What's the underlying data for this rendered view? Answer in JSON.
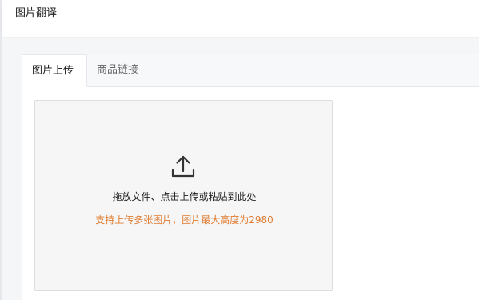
{
  "page": {
    "title": "图片翻译"
  },
  "tabs": [
    {
      "label": "图片上传",
      "active": true
    },
    {
      "label": "商品链接",
      "active": false
    }
  ],
  "upload": {
    "icon": "upload-icon",
    "instruction": "拖放文件、点击上传或粘贴到此处",
    "hint": "支持上传多张图片，图片最大高度为2980"
  },
  "colors": {
    "hint_color": "#e07b2f",
    "background": "#f5f6f8",
    "panel": "#ffffff",
    "upload_bg": "#f6f6f6"
  }
}
